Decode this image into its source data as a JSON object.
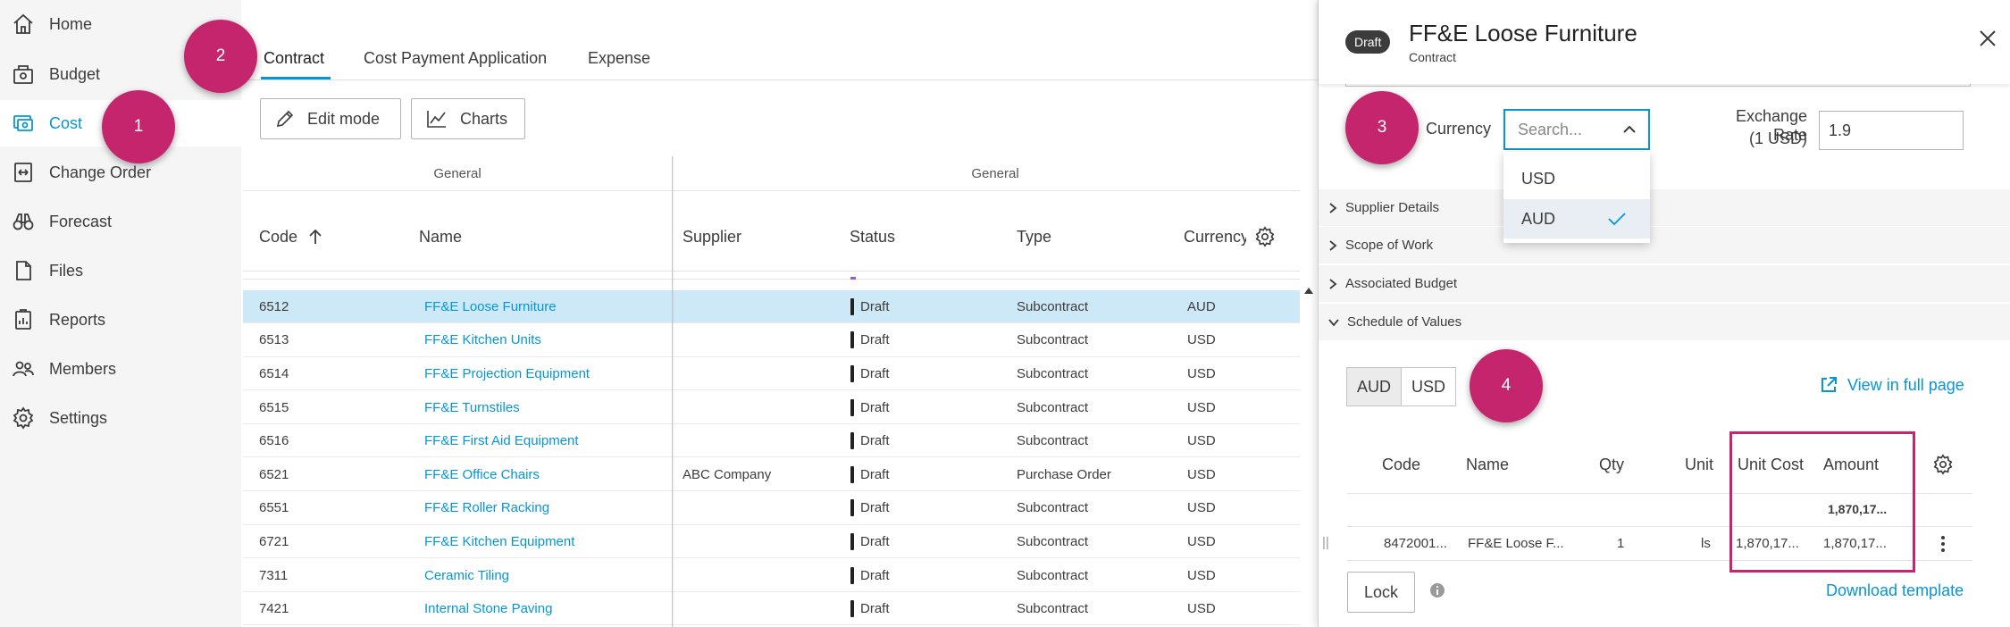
{
  "sidebar": {
    "items": [
      {
        "label": "Home",
        "icon": "home-icon"
      },
      {
        "label": "Budget",
        "icon": "budget-icon"
      },
      {
        "label": "Cost",
        "icon": "cost-icon",
        "active": true
      },
      {
        "label": "Change Order",
        "icon": "change-order-icon"
      },
      {
        "label": "Forecast",
        "icon": "binoculars-icon"
      },
      {
        "label": "Files",
        "icon": "file-icon"
      },
      {
        "label": "Reports",
        "icon": "reports-icon"
      },
      {
        "label": "Members",
        "icon": "members-icon"
      },
      {
        "label": "Settings",
        "icon": "gear-icon"
      }
    ]
  },
  "badges": [
    "1",
    "2",
    "3",
    "4"
  ],
  "tabs": [
    {
      "label": "Contract",
      "active": true
    },
    {
      "label": "Cost Payment Application"
    },
    {
      "label": "Expense"
    }
  ],
  "toolbar": {
    "edit_label": "Edit mode",
    "charts_label": "Charts"
  },
  "grid": {
    "group_left": "General",
    "group_right": "General",
    "columns": [
      "Code",
      "Name",
      "Supplier",
      "Status",
      "Type",
      "Currency"
    ],
    "rows": [
      {
        "code": "6512",
        "name": "FF&E Loose Furniture",
        "supplier": "",
        "status": "Draft",
        "type": "Subcontract",
        "currency": "AUD"
      },
      {
        "code": "6513",
        "name": "FF&E Kitchen Units",
        "supplier": "",
        "status": "Draft",
        "type": "Subcontract",
        "currency": "USD"
      },
      {
        "code": "6514",
        "name": "FF&E Projection Equipment",
        "supplier": "",
        "status": "Draft",
        "type": "Subcontract",
        "currency": "USD"
      },
      {
        "code": "6515",
        "name": "FF&E Turnstiles",
        "supplier": "",
        "status": "Draft",
        "type": "Subcontract",
        "currency": "USD"
      },
      {
        "code": "6516",
        "name": "FF&E First Aid Equipment",
        "supplier": "",
        "status": "Draft",
        "type": "Subcontract",
        "currency": "USD"
      },
      {
        "code": "6521",
        "name": "FF&E Office Chairs",
        "supplier": "ABC Company",
        "status": "Draft",
        "type": "Purchase Order",
        "currency": "USD"
      },
      {
        "code": "6551",
        "name": "FF&E Roller Racking",
        "supplier": "",
        "status": "Draft",
        "type": "Subcontract",
        "currency": "USD"
      },
      {
        "code": "6721",
        "name": "FF&E Kitchen Equipment",
        "supplier": "",
        "status": "Draft",
        "type": "Subcontract",
        "currency": "USD"
      },
      {
        "code": "7311",
        "name": "Ceramic Tiling",
        "supplier": "",
        "status": "Draft",
        "type": "Subcontract",
        "currency": "USD"
      },
      {
        "code": "7421",
        "name": "Internal Stone Paving",
        "supplier": "",
        "status": "Draft",
        "type": "Subcontract",
        "currency": "USD"
      }
    ]
  },
  "panel": {
    "status": "Draft",
    "title": "FF&E Loose Furniture",
    "subtitle": "Contract",
    "currency_label": "Currency",
    "currency_placeholder": "Search...",
    "currency_options": [
      "USD",
      "AUD"
    ],
    "currency_selected": "AUD",
    "rate_label_1": "Exchange Rate",
    "rate_label_2": "(1 USD)",
    "rate_value": "1.9",
    "sections": [
      "Supplier Details",
      "Scope of Work",
      "Associated Budget",
      "Schedule of Values"
    ],
    "toggle": [
      "AUD",
      "USD"
    ],
    "toggle_selected": "AUD",
    "view_full_page": "View in full page",
    "sov_columns": [
      "Code",
      "Name",
      "Qty",
      "Unit",
      "Unit Cost",
      "Amount"
    ],
    "sov_total": "1,870,17...",
    "sov_row": {
      "code": "8472001...",
      "name": "FF&E Loose F...",
      "qty": "1",
      "unit": "ls",
      "unit_cost": "1,870,17...",
      "amount": "1,870,17..."
    },
    "lock_label": "Lock",
    "download_template": "Download template"
  },
  "colors": {
    "accent": "#0696d7",
    "badge": "#c4256c",
    "selected_row": "#cde8f6"
  }
}
